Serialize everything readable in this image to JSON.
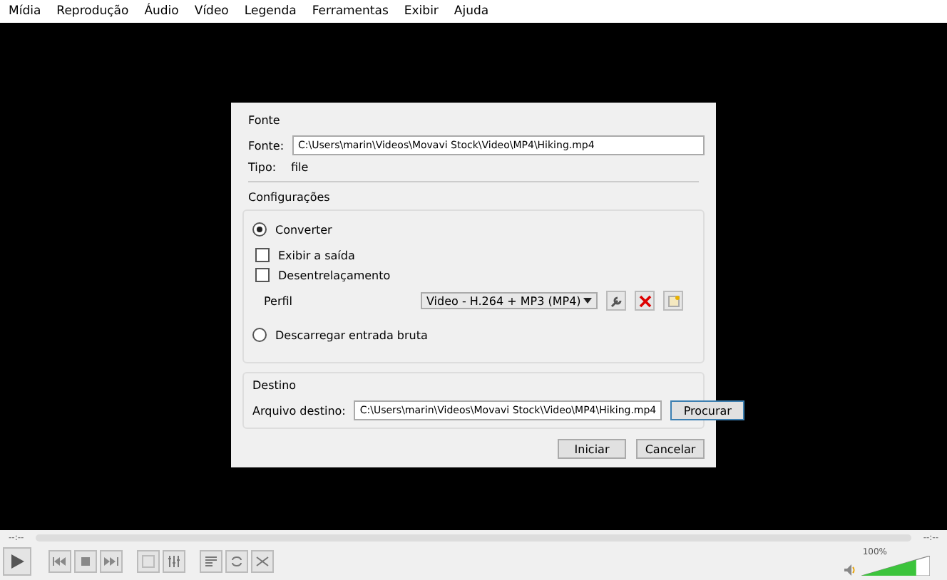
{
  "menu": [
    "Mídia",
    "Reprodução",
    "Áudio",
    "Vídeo",
    "Legenda",
    "Ferramentas",
    "Exibir",
    "Ajuda"
  ],
  "dialog": {
    "source": {
      "title": "Fonte",
      "label": "Fonte:",
      "value": "C:\\Users\\marin\\Videos\\Movavi Stock\\Video\\MP4\\Hiking.mp4",
      "type_label": "Tipo:",
      "type_value": "file"
    },
    "settings": {
      "title": "Configurações",
      "options": [
        {
          "label": "Converter",
          "selected": true
        },
        {
          "label": "Descarregar entrada bruta",
          "selected": false
        }
      ],
      "checks": [
        {
          "label": "Exibir a saída",
          "checked": false
        },
        {
          "label": "Desentrelaçamento",
          "checked": false
        }
      ],
      "profile_label": "Perfil",
      "profile_value": "Video - H.264 + MP3 (MP4)"
    },
    "destination": {
      "title": "Destino",
      "label": "Arquivo destino:",
      "value": "C:\\Users\\marin\\Videos\\Movavi Stock\\Video\\MP4\\Hiking.mp4",
      "browse": "Procurar"
    },
    "buttons": [
      "Iniciar",
      "Cancelar"
    ]
  },
  "player": {
    "elapsed": "--:--",
    "remaining": "--:--",
    "volume_reading": "100%",
    "volume": {
      "level": 0.8
    }
  }
}
